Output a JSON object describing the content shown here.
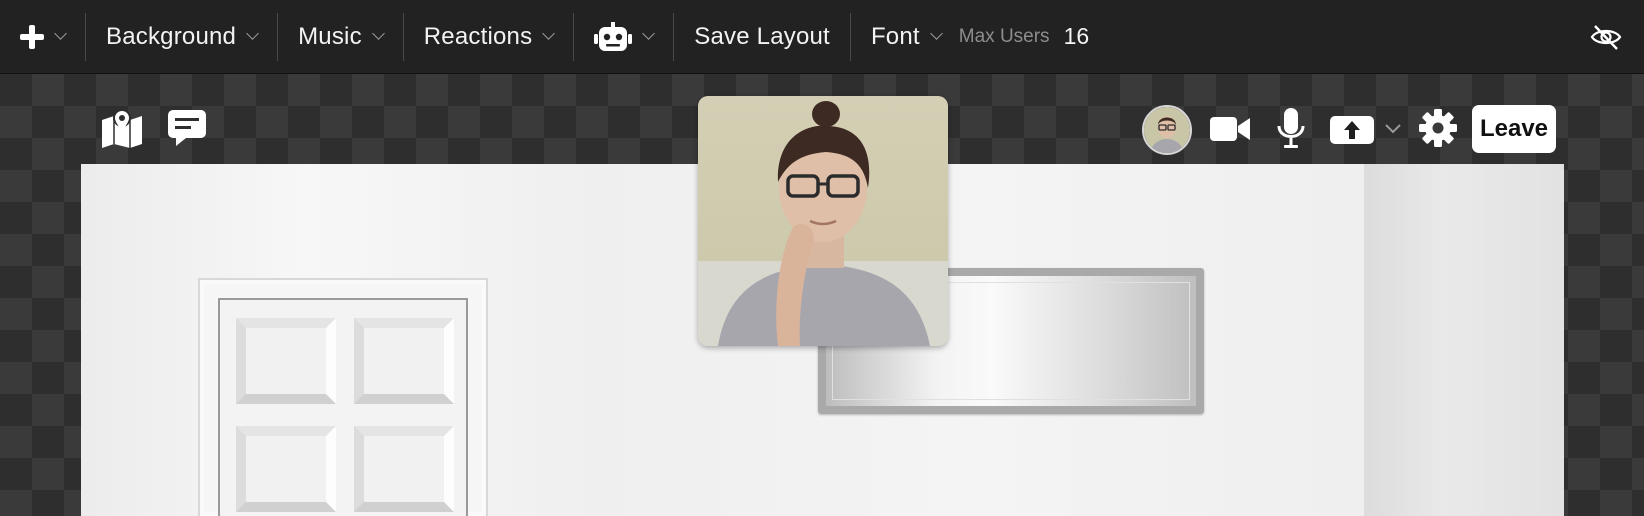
{
  "toolbar": {
    "add_icon": "plus-icon",
    "background_label": "Background",
    "music_label": "Music",
    "reactions_label": "Reactions",
    "bot_icon": "robot-icon",
    "save_layout_label": "Save Layout",
    "font_label": "Font",
    "max_users_label": "Max Users",
    "max_users_value": "16",
    "visibility_icon": "eye-slash-icon"
  },
  "overlay": {
    "left_icons": [
      "map-icon",
      "chat-icon"
    ],
    "right_icons": [
      "avatar",
      "video-camera-icon",
      "microphone-icon",
      "screen-share-icon",
      "gear-icon"
    ],
    "leave_label": "Leave"
  },
  "colors": {
    "toolbar_bg": "#222222",
    "canvas_check_dark": "#2e2e2e",
    "canvas_check_light": "#3a3a3a",
    "room_wall": "#f0f0f0",
    "accent_white": "#ffffff"
  }
}
